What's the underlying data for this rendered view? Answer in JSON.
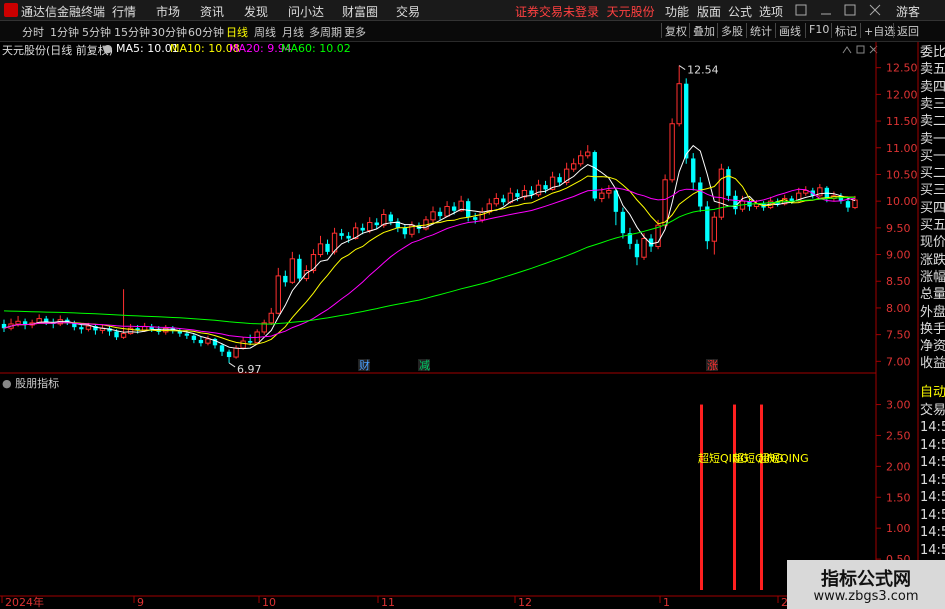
{
  "app": {
    "title": "通达信金融终端"
  },
  "menu": [
    "行情",
    "市场",
    "资讯",
    "发现",
    "问小达",
    "财富圈",
    "交易"
  ],
  "status": {
    "notice": "证券交易未登录",
    "stock_name": "天元股份"
  },
  "right_menu": [
    "功能",
    "版面",
    "公式",
    "选项",
    "游客"
  ],
  "periods": [
    "分时",
    "1分钟",
    "5分钟",
    "15分钟",
    "30分钟",
    "60分钟",
    "日线",
    "周线",
    "月线",
    "多周期",
    "更多"
  ],
  "active_period": "日线",
  "tools": [
    "复权",
    "叠加",
    "多股",
    "统计",
    "画线",
    "F10",
    "标记",
    "+自选",
    "返回"
  ],
  "info": {
    "title": "天元股份(日线 前复权)",
    "ma": [
      {
        "label": "MA5: 10.01",
        "color": "#ffffff"
      },
      {
        "label": "MA10: 10.08",
        "color": "#ffff00"
      },
      {
        "label": "MA20: 9.94",
        "color": "#ff00ff"
      },
      {
        "label": "MA60: 10.02",
        "color": "#00ff00"
      }
    ]
  },
  "sidebar": [
    "委比",
    "卖五",
    "卖四",
    "卖三",
    "卖二",
    "卖一",
    "买一",
    "买二",
    "买三",
    "买四",
    "买五",
    "现价",
    "涨跌",
    "涨幅",
    "总量",
    "外盘",
    "换手",
    "净资",
    "收益"
  ],
  "sub_sidebar": [
    "自动",
    "交易",
    "14:56",
    "14:56",
    "14:56",
    "14:56",
    "14:56",
    "14:56",
    "14:56",
    "14:56"
  ],
  "sub_indicator": {
    "title": "股朋指标",
    "signal_label": "超短QING"
  },
  "markers": [
    {
      "text": "财",
      "color": "#4aa0ff"
    },
    {
      "text": "减",
      "color": "#00cc66"
    },
    {
      "text": "涨",
      "color": "#ff3030"
    }
  ],
  "watermark": {
    "line1": "指标公式网",
    "line2": "www.zbgs3.com"
  },
  "chart_data": [
    {
      "type": "candlestick",
      "title": "天元股份(日线 前复权)",
      "y_ticks": [
        "12.50",
        "12.00",
        "11.50",
        "11.00",
        "10.50",
        "10.00",
        "9.50",
        "9.00",
        "8.50",
        "8.00",
        "7.50",
        "7.00"
      ],
      "ylim": [
        6.8,
        12.7
      ],
      "x_labels": [
        "2024年",
        "9",
        "10",
        "11",
        "12",
        "1",
        "2"
      ],
      "annotations": {
        "high": "12.54",
        "low": "6.97"
      },
      "colors": {
        "up": "#ff3030",
        "down": "#00ffff",
        "ma5": "#ffffff",
        "ma10": "#ffff00",
        "ma20": "#ff00ff",
        "ma60": "#00ff00"
      },
      "candles": [
        [
          7.7,
          7.62,
          7.78,
          7.55
        ],
        [
          7.62,
          7.7,
          7.8,
          7.58
        ],
        [
          7.7,
          7.75,
          7.85,
          7.65
        ],
        [
          7.75,
          7.68,
          7.8,
          7.6
        ],
        [
          7.68,
          7.72,
          7.78,
          7.62
        ],
        [
          7.72,
          7.8,
          7.88,
          7.7
        ],
        [
          7.8,
          7.74,
          7.85,
          7.68
        ],
        [
          7.74,
          7.7,
          7.8,
          7.62
        ],
        [
          7.7,
          7.78,
          7.86,
          7.66
        ],
        [
          7.78,
          7.72,
          7.82,
          7.68
        ],
        [
          7.72,
          7.64,
          7.76,
          7.58
        ],
        [
          7.64,
          7.6,
          7.7,
          7.52
        ],
        [
          7.6,
          7.66,
          7.72,
          7.56
        ],
        [
          7.66,
          7.58,
          7.7,
          7.5
        ],
        [
          7.58,
          7.62,
          7.68,
          7.52
        ],
        [
          7.62,
          7.56,
          7.66,
          7.48
        ],
        [
          7.56,
          7.45,
          7.6,
          7.4
        ],
        [
          7.45,
          7.52,
          8.35,
          7.42
        ],
        [
          7.52,
          7.62,
          7.7,
          7.5
        ],
        [
          7.62,
          7.58,
          7.68,
          7.52
        ],
        [
          7.58,
          7.65,
          7.72,
          7.55
        ],
        [
          7.65,
          7.6,
          7.7,
          7.55
        ],
        [
          7.6,
          7.55,
          7.66,
          7.5
        ],
        [
          7.55,
          7.62,
          7.68,
          7.5
        ],
        [
          7.62,
          7.58,
          7.66,
          7.52
        ],
        [
          7.58,
          7.52,
          7.62,
          7.46
        ],
        [
          7.52,
          7.48,
          7.58,
          7.42
        ],
        [
          7.48,
          7.4,
          7.52,
          7.34
        ],
        [
          7.4,
          7.34,
          7.46,
          7.28
        ],
        [
          7.34,
          7.42,
          7.48,
          7.3
        ],
        [
          7.42,
          7.3,
          7.44,
          7.24
        ],
        [
          7.3,
          7.18,
          7.34,
          7.1
        ],
        [
          7.18,
          7.08,
          7.22,
          6.97
        ],
        [
          7.08,
          7.25,
          7.3,
          7.05
        ],
        [
          7.25,
          7.38,
          7.45,
          7.22
        ],
        [
          7.38,
          7.35,
          7.5,
          7.3
        ],
        [
          7.35,
          7.55,
          7.6,
          7.32
        ],
        [
          7.55,
          7.72,
          7.78,
          7.5
        ],
        [
          7.72,
          7.9,
          8.0,
          7.68
        ],
        [
          7.9,
          8.6,
          8.75,
          7.88
        ],
        [
          8.6,
          8.48,
          8.7,
          8.4
        ],
        [
          8.48,
          8.92,
          9.05,
          8.45
        ],
        [
          8.92,
          8.55,
          9.0,
          8.5
        ],
        [
          8.55,
          8.7,
          8.8,
          8.5
        ],
        [
          8.7,
          9.0,
          9.1,
          8.65
        ],
        [
          9.0,
          9.2,
          9.35,
          8.95
        ],
        [
          9.2,
          9.05,
          9.28,
          9.0
        ],
        [
          9.05,
          9.4,
          9.5,
          9.0
        ],
        [
          9.4,
          9.35,
          9.48,
          9.28
        ],
        [
          9.35,
          9.3,
          9.42,
          9.22
        ],
        [
          9.3,
          9.5,
          9.6,
          9.28
        ],
        [
          9.5,
          9.45,
          9.58,
          9.38
        ],
        [
          9.45,
          9.6,
          9.7,
          9.4
        ],
        [
          9.6,
          9.55,
          9.68,
          9.48
        ],
        [
          9.55,
          9.75,
          9.85,
          9.5
        ],
        [
          9.75,
          9.62,
          9.8,
          9.55
        ],
        [
          9.62,
          9.5,
          9.68,
          9.42
        ],
        [
          9.5,
          9.38,
          9.55,
          9.3
        ],
        [
          9.38,
          9.55,
          9.62,
          9.32
        ],
        [
          9.55,
          9.48,
          9.6,
          9.4
        ],
        [
          9.48,
          9.65,
          9.72,
          9.45
        ],
        [
          9.65,
          9.8,
          9.9,
          9.6
        ],
        [
          9.8,
          9.72,
          9.88,
          9.65
        ],
        [
          9.72,
          9.9,
          10.0,
          9.7
        ],
        [
          9.9,
          9.82,
          9.98,
          9.75
        ],
        [
          9.82,
          10.0,
          10.1,
          9.8
        ],
        [
          10.0,
          9.7,
          10.05,
          9.62
        ],
        [
          9.7,
          9.65,
          9.78,
          9.58
        ],
        [
          9.65,
          9.8,
          9.88,
          9.6
        ],
        [
          9.8,
          9.95,
          10.05,
          9.75
        ],
        [
          9.95,
          10.05,
          10.15,
          9.9
        ],
        [
          10.05,
          9.98,
          10.12,
          9.92
        ],
        [
          9.98,
          10.15,
          10.25,
          9.95
        ],
        [
          10.15,
          10.08,
          10.22,
          10.0
        ],
        [
          10.08,
          10.2,
          10.3,
          10.02
        ],
        [
          10.2,
          10.12,
          10.28,
          10.05
        ],
        [
          10.12,
          10.3,
          10.4,
          10.08
        ],
        [
          10.3,
          10.22,
          10.38,
          10.15
        ],
        [
          10.22,
          10.45,
          10.55,
          10.2
        ],
        [
          10.45,
          10.35,
          10.52,
          10.28
        ],
        [
          10.35,
          10.6,
          10.72,
          10.3
        ],
        [
          10.6,
          10.7,
          10.8,
          10.55
        ],
        [
          10.7,
          10.85,
          10.95,
          10.65
        ],
        [
          10.85,
          10.92,
          11.05,
          10.8
        ],
        [
          10.92,
          10.05,
          10.95,
          10.0
        ],
        [
          10.05,
          10.15,
          10.25,
          9.98
        ],
        [
          10.15,
          10.2,
          10.3,
          10.05
        ],
        [
          10.2,
          9.8,
          10.25,
          9.55
        ],
        [
          9.8,
          9.4,
          9.88,
          9.3
        ],
        [
          9.4,
          9.2,
          9.5,
          9.1
        ],
        [
          9.2,
          8.95,
          9.28,
          8.8
        ],
        [
          8.95,
          9.3,
          9.4,
          8.9
        ],
        [
          9.3,
          9.15,
          9.38,
          9.05
        ],
        [
          9.15,
          9.55,
          9.65,
          9.1
        ],
        [
          9.55,
          10.4,
          10.5,
          9.5
        ],
        [
          10.4,
          11.45,
          11.55,
          10.35
        ],
        [
          11.45,
          12.2,
          12.54,
          11.4
        ],
        [
          12.2,
          10.8,
          12.3,
          10.7
        ],
        [
          10.8,
          10.35,
          10.9,
          10.2
        ],
        [
          10.35,
          9.9,
          10.45,
          9.8
        ],
        [
          9.9,
          9.25,
          10.0,
          9.1
        ],
        [
          9.25,
          9.7,
          9.8,
          9.0
        ],
        [
          9.7,
          10.6,
          10.7,
          9.65
        ],
        [
          10.6,
          10.1,
          10.65,
          10.0
        ],
        [
          10.1,
          9.85,
          10.2,
          9.75
        ],
        [
          9.85,
          10.0,
          10.1,
          9.8
        ],
        [
          10.0,
          9.9,
          10.05,
          9.82
        ],
        [
          9.9,
          9.95,
          10.02,
          9.85
        ],
        [
          9.95,
          9.88,
          10.0,
          9.82
        ],
        [
          9.88,
          10.0,
          10.08,
          9.85
        ],
        [
          10.0,
          9.95,
          10.05,
          9.9
        ],
        [
          9.95,
          10.05,
          10.12,
          9.92
        ],
        [
          10.05,
          10.0,
          10.1,
          9.95
        ],
        [
          10.0,
          10.15,
          10.25,
          9.98
        ],
        [
          10.15,
          10.2,
          10.28,
          10.1
        ],
        [
          10.2,
          10.1,
          10.25,
          10.05
        ],
        [
          10.1,
          10.25,
          10.32,
          10.08
        ],
        [
          10.25,
          10.05,
          10.28,
          9.98
        ],
        [
          10.05,
          10.1,
          10.18,
          10.0
        ],
        [
          10.1,
          10.0,
          10.15,
          9.95
        ],
        [
          10.0,
          9.88,
          10.05,
          9.8
        ],
        [
          9.88,
          10.02,
          10.1,
          9.85
        ]
      ]
    },
    {
      "type": "bar",
      "title": "股朋指标",
      "y_ticks": [
        "3.00",
        "2.50",
        "2.00",
        "1.50",
        "1.00",
        "0.50"
      ],
      "ylim": [
        0,
        3.3
      ],
      "series": [
        {
          "name": "超短QING",
          "values": [
            3.0,
            3.0,
            3.0
          ]
        }
      ]
    }
  ]
}
